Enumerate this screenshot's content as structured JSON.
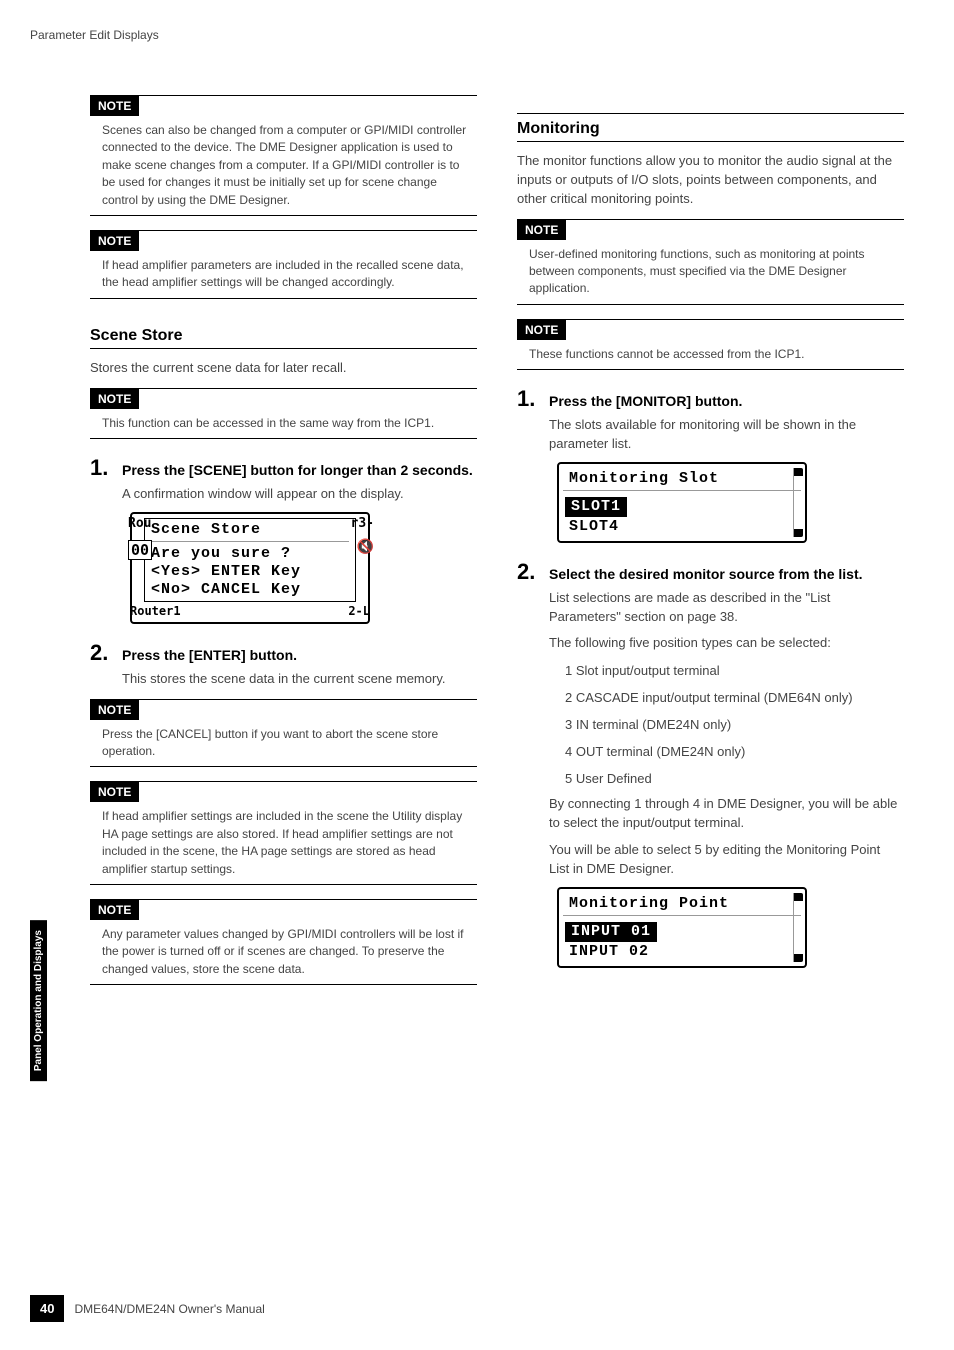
{
  "header": "Parameter Edit Displays",
  "side_tab": "Panel Operation and Displays",
  "page_number": "40",
  "manual_title": "DME64N/DME24N Owner's Manual",
  "left": {
    "note1": "Scenes can also be changed from a computer or GPI/MIDI controller connected to the device.\nThe DME Designer application is used to make scene changes from a computer. If a GPI/MIDI controller is to be used for changes it must be initially set up for scene change control by using the DME Designer.",
    "note2": "If head amplifier parameters are included in the recalled scene data, the head amplifier settings will be changed accordingly.",
    "section_title": "Scene Store",
    "section_desc": "Stores the current scene data for later recall.",
    "note3": "This function can be accessed in the same way from the ICP1.",
    "step1_title": "Press the [SCENE] button for longer than 2 seconds.",
    "step1_body": "A confirmation window will appear on the display.",
    "lcd1": {
      "left_tag_top": "Rou",
      "right_tag_top": "r3-",
      "title": "Scene Store",
      "line1": "Are you sure ?",
      "line2": "<Yes> ENTER Key",
      "line3": "<No>  CANCEL Key",
      "zero_box": "00",
      "left_tag_bot": "Router1",
      "right_tag_bot": "2-L"
    },
    "step2_title": "Press the [ENTER] button.",
    "step2_body": "This stores the scene data in the current scene memory.",
    "note4": "Press the [CANCEL] button if you want to abort the scene store operation.",
    "note5": "If head amplifier settings are included in the scene the Utility display HA page settings are also stored. If head amplifier settings are not included in the scene, the HA page settings are stored as head amplifier startup settings.",
    "note6": "Any parameter values changed by GPI/MIDI controllers will be lost if the power is turned off or if scenes are changed. To preserve the changed values, store the scene data."
  },
  "right": {
    "section_title": "Monitoring",
    "section_desc": "The monitor functions allow you to monitor the audio signal at the inputs or outputs of I/O slots, points between components, and other critical monitoring points.",
    "note1": "User-defined monitoring functions, such as monitoring at points between components, must specified via the DME Designer application.",
    "note2": "These functions cannot be accessed from the ICP1.",
    "step1_title": "Press the [MONITOR] button.",
    "step1_body": "The slots available for monitoring will be shown in the parameter list.",
    "lcd1": {
      "title": "Monitoring Slot",
      "row1": "SLOT1",
      "row2": "SLOT4"
    },
    "step2_title": "Select the desired monitor source from the list.",
    "step2_body1": "List selections are made as described in the \"List Parameters\" section on page 38.",
    "step2_body2": "The following five position types can be selected:",
    "step2_items": [
      "1 Slot input/output terminal",
      "2 CASCADE input/output terminal (DME64N only)",
      "3 IN terminal (DME24N only)",
      "4 OUT terminal (DME24N only)",
      "5 User Defined"
    ],
    "step2_body3": "By connecting 1 through 4 in DME Designer, you will be able to select the input/output terminal.",
    "step2_body4": "You will be able to select 5 by editing the Monitoring Point List in DME Designer.",
    "lcd2": {
      "title": "Monitoring Point",
      "row1": "INPUT 01",
      "row2": "INPUT 02"
    }
  },
  "note_label": "NOTE"
}
